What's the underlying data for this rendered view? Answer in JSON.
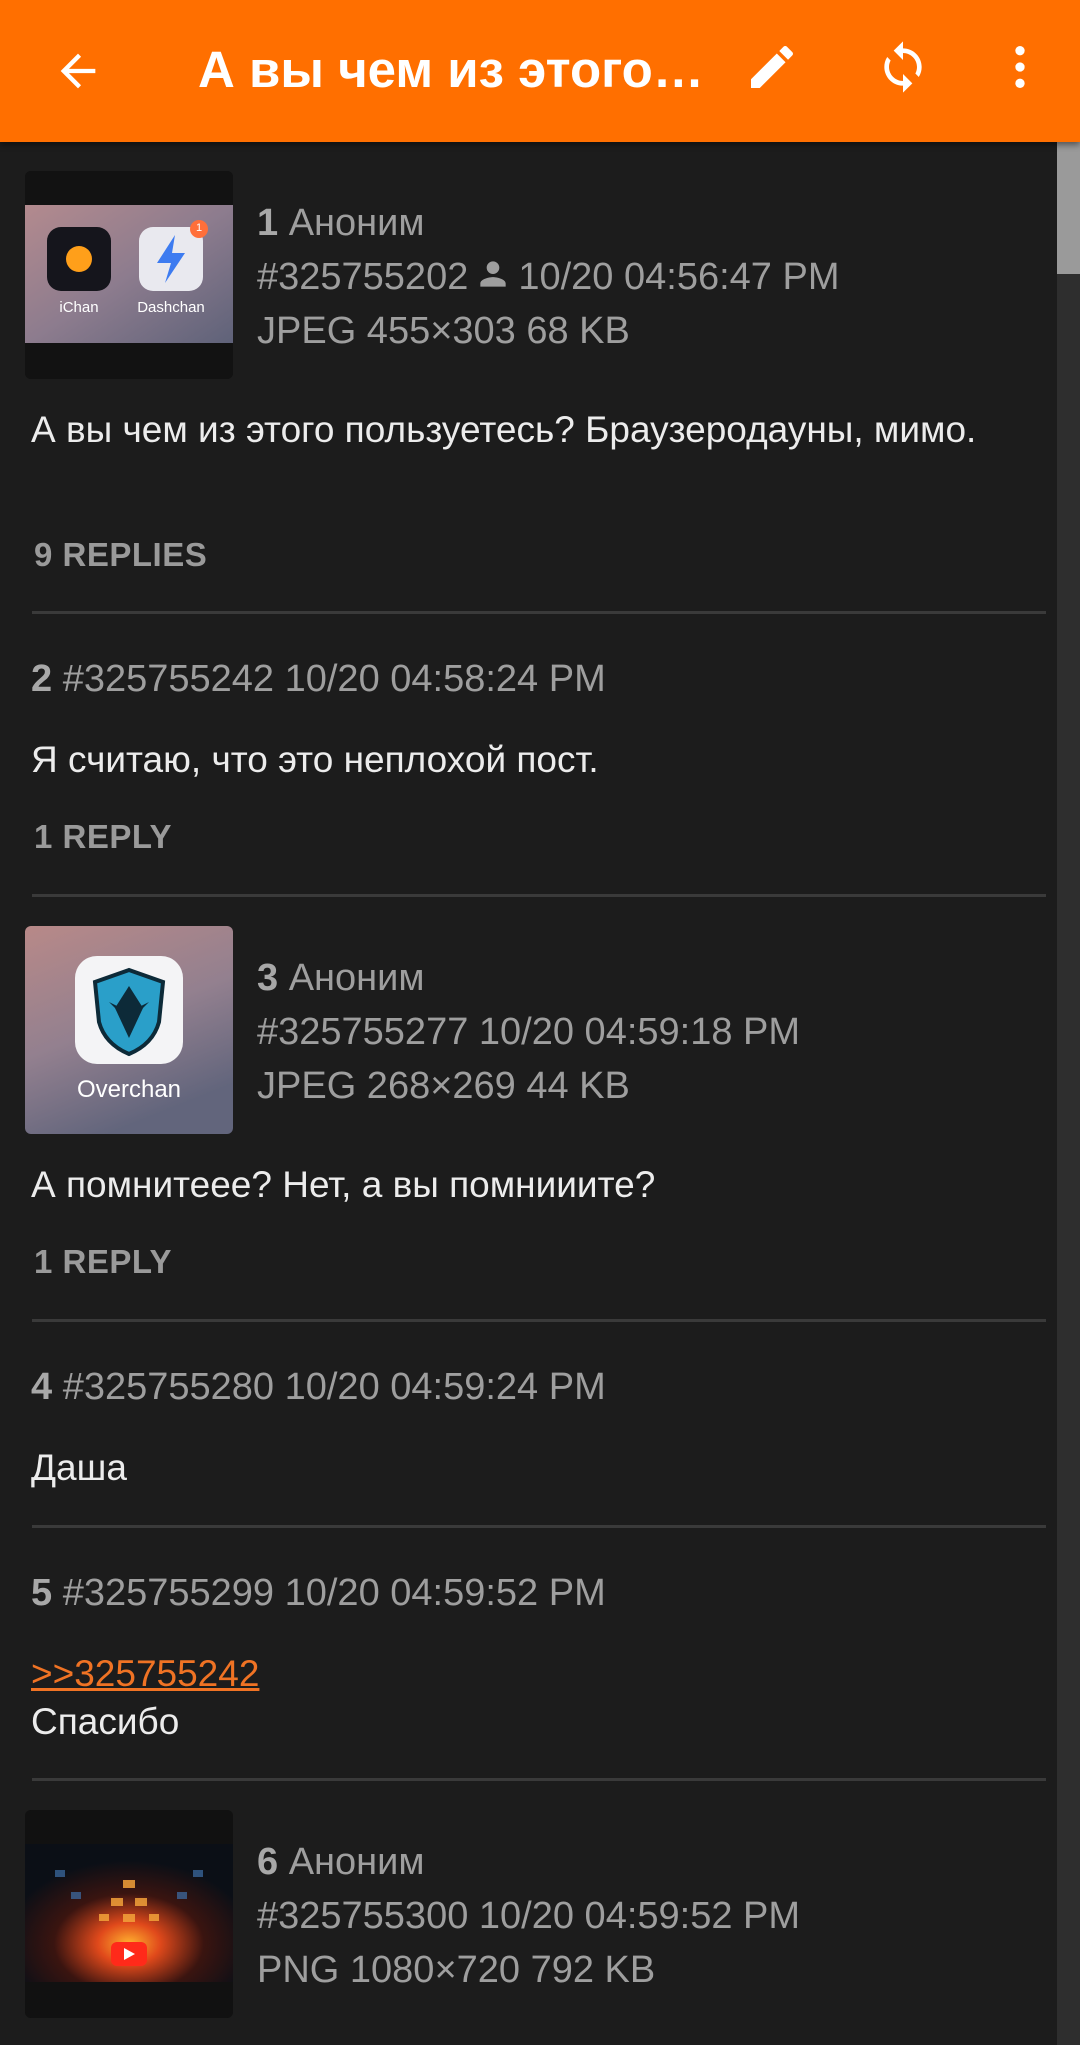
{
  "appbar": {
    "title": "А вы чем из этого…",
    "back_icon": "arrow-back-icon",
    "edit_icon": "pencil-icon",
    "refresh_icon": "refresh-icon",
    "menu_icon": "more-vert-icon",
    "color": "#ff6f00"
  },
  "posts": [
    {
      "number": "1",
      "name": "Аноним",
      "id": "#325755202",
      "time": "10/20 04:56:47 PM",
      "file": "JPEG 455×303 68 KB",
      "thumb_labels": [
        "iChan",
        "Dashchan"
      ],
      "thumb_badge": "1",
      "text": "А вы чем из этого пользуетесь? Браузеродауны, мимо.",
      "replies": "9 REPLIES"
    },
    {
      "number": "2",
      "id": "#325755242",
      "time": "10/20 04:58:24 PM",
      "text": "Я считаю, что это неплохой пост.",
      "replies": "1 REPLY"
    },
    {
      "number": "3",
      "name": "Аноним",
      "id": "#325755277",
      "time": "10/20 04:59:18 PM",
      "file": "JPEG 268×269 44 KB",
      "thumb_label": "Overchan",
      "text": "А помнитеее? Нет, а вы помнииите?",
      "replies": "1 REPLY"
    },
    {
      "number": "4",
      "id": "#325755280",
      "time": "10/20 04:59:24 PM",
      "text": "Даша"
    },
    {
      "number": "5",
      "id": "#325755299",
      "time": "10/20 04:59:52 PM",
      "quote": ">>325755242",
      "text": "Спасибо"
    },
    {
      "number": "6",
      "name": "Аноним",
      "id": "#325755300",
      "time": "10/20 04:59:52 PM",
      "file": "PNG 1080×720 792 KB"
    }
  ],
  "colors": {
    "background": "#1c1c1c",
    "link": "#f07324",
    "meta": "#9e9e9e"
  }
}
